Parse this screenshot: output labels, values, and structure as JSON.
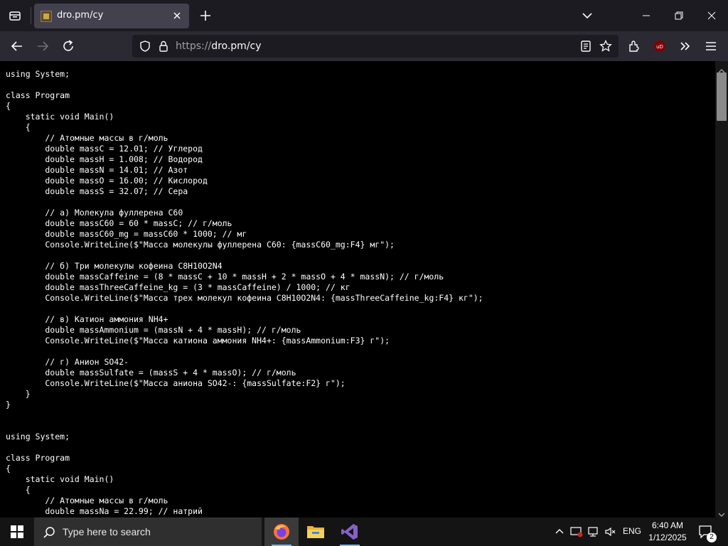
{
  "browser": {
    "tab": {
      "title": "dro.pm/cy"
    },
    "url": {
      "protocol": "https://",
      "host": "dro.pm/cy"
    },
    "icons": [
      "tab-overview-icon",
      "close-icon",
      "plus-icon",
      "chevron-down-icon",
      "minimize-icon",
      "maximize-icon",
      "close-window-icon",
      "back-icon",
      "forward-icon",
      "reload-icon",
      "shield-icon",
      "lock-icon",
      "reader-view-icon",
      "star-icon",
      "extensions-icon",
      "ublock-icon",
      "overflow-icon",
      "menu-icon"
    ]
  },
  "page": {
    "code_lines": [
      "using System;",
      "",
      "class Program",
      "{",
      "    static void Main()",
      "    {",
      "        // Атомные массы в г/моль",
      "        double massC = 12.01; // Углерод",
      "        double massH = 1.008; // Водород",
      "        double massN = 14.01; // Азот",
      "        double massO = 16.00; // Кислород",
      "        double massS = 32.07; // Сера",
      "",
      "        // а) Молекула фуллерена C60",
      "        double massC60 = 60 * massC; // г/моль",
      "        double massC60_mg = massC60 * 1000; // мг",
      "        Console.WriteLine($\"Масса молекулы фуллерена C60: {massC60_mg:F4} мг\");",
      "",
      "        // б) Три молекулы кофеина C8H10O2N4",
      "        double massCaffeine = (8 * massC + 10 * massH + 2 * massO + 4 * massN); // г/моль",
      "        double massThreeCaffeine_kg = (3 * massCaffeine) / 1000; // кг",
      "        Console.WriteLine($\"Масса трех молекул кофеина C8H10O2N4: {massThreeCaffeine_kg:F4} кг\");",
      "",
      "        // в) Катион аммония NH4+",
      "        double massAmmonium = (massN + 4 * massH); // г/моль",
      "        Console.WriteLine($\"Масса катиона аммония NH4+: {massAmmonium:F3} г\");",
      "",
      "        // г) Анион SO42-",
      "        double massSulfate = (massS + 4 * massO); // г/моль",
      "        Console.WriteLine($\"Масса аниона SO42-: {massSulfate:F2} г\");",
      "    }",
      "}",
      "",
      "",
      "using System;",
      "",
      "class Program",
      "{",
      "    static void Main()",
      "    {",
      "        // Атомные массы в г/моль",
      "        double massNa = 22.99; // натрий"
    ]
  },
  "taskbar": {
    "search_placeholder": "Type here to search",
    "language": "ENG",
    "time": "6:40 AM",
    "date": "1/12/2025",
    "notification_count": "2",
    "apps": [
      "firefox-icon",
      "file-explorer-icon",
      "visual-studio-icon"
    ]
  }
}
